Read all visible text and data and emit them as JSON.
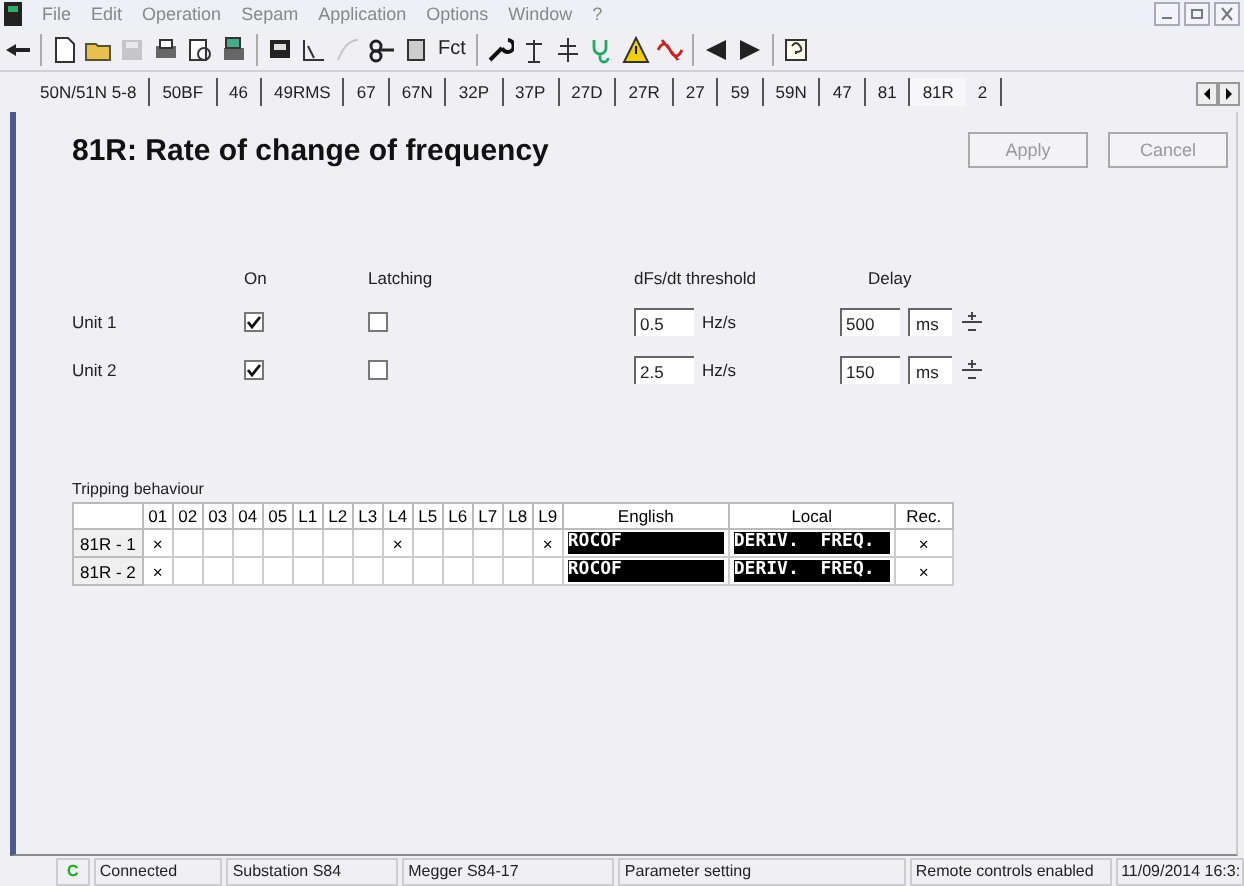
{
  "menu": [
    "File",
    "Edit",
    "Operation",
    "Sepam",
    "Application",
    "Options",
    "Window",
    "?"
  ],
  "toolbar": {
    "fct_label": "Fct"
  },
  "tabs": [
    {
      "label": "50N/51N 5-8",
      "selected": false
    },
    {
      "label": "50BF",
      "selected": false
    },
    {
      "label": "46",
      "selected": false
    },
    {
      "label": "49RMS",
      "selected": false
    },
    {
      "label": "67",
      "selected": false
    },
    {
      "label": "67N",
      "selected": false
    },
    {
      "label": "32P",
      "selected": false
    },
    {
      "label": "37P",
      "selected": false
    },
    {
      "label": "27D",
      "selected": false
    },
    {
      "label": "27R",
      "selected": false
    },
    {
      "label": "27",
      "selected": false
    },
    {
      "label": "59",
      "selected": false
    },
    {
      "label": "59N",
      "selected": false
    },
    {
      "label": "47",
      "selected": false
    },
    {
      "label": "81",
      "selected": false
    },
    {
      "label": "81R",
      "selected": true
    },
    {
      "label": "2",
      "selected": false
    }
  ],
  "title": "81R: Rate of change of frequency",
  "buttons": [
    {
      "label": "Apply",
      "disabled": true
    },
    {
      "label": "Cancel",
      "disabled": true
    }
  ],
  "unit_headers": {
    "on": "On",
    "latching": "Latching",
    "threshold": "dFs/dt threshold",
    "delay": "Delay"
  },
  "units": [
    {
      "name": "Unit 1",
      "on": true,
      "latching": false,
      "threshold": "0.5",
      "threshold_unit": "Hz/s",
      "delay": "500",
      "delay_unit": "ms"
    },
    {
      "name": "Unit 2",
      "on": true,
      "latching": false,
      "threshold": "2.5",
      "threshold_unit": "Hz/s",
      "delay": "150",
      "delay_unit": "ms"
    }
  ],
  "tripping": {
    "label": "Tripping behaviour",
    "outputs": [
      "01",
      "02",
      "03",
      "04",
      "05",
      "L1",
      "L2",
      "L3",
      "L4",
      "L5",
      "L6",
      "L7",
      "L8",
      "L9"
    ],
    "english_header": "English",
    "local_header": "Local",
    "rec_header": "Rec.",
    "rows": [
      {
        "name": "81R - 1",
        "marks": [
          true,
          false,
          false,
          false,
          false,
          false,
          false,
          false,
          true,
          false,
          false,
          false,
          false,
          true
        ],
        "english": "ROCOF",
        "local": "DERIV.  FREQ.",
        "rec": true
      },
      {
        "name": "81R - 2",
        "marks": [
          true,
          false,
          false,
          false,
          false,
          false,
          false,
          false,
          false,
          false,
          false,
          false,
          false,
          false
        ],
        "english": "ROCOF",
        "local": "DERIV.  FREQ.",
        "rec": true
      }
    ],
    "mark": "×"
  },
  "status": {
    "connection": "C",
    "connection_label": "Connected",
    "fields": [
      "Substation S84",
      "Megger S84-17",
      "Parameter setting",
      "Remote controls enabled",
      "11/09/2014  16:3:"
    ]
  }
}
